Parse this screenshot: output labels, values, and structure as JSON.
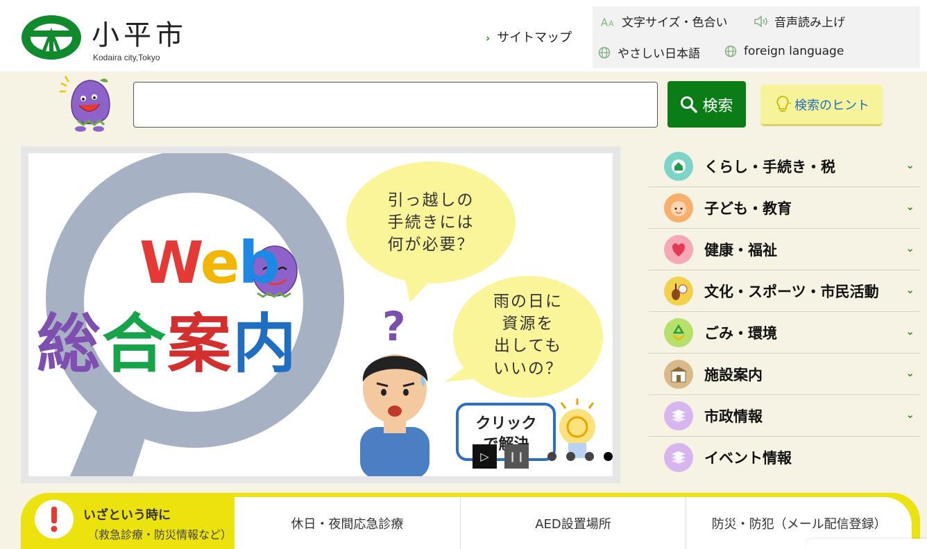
{
  "header": {
    "logo_name": "小平市",
    "logo_sub": "Kodaira city,Tokyo",
    "sitemap_label": "サイトマップ",
    "utility": {
      "font_color_label": "文字サイズ・色合い",
      "voice_label": "音声読み上げ",
      "easy_japanese_label": "やさしい日本語",
      "foreign_language_label": "foreign language"
    }
  },
  "search": {
    "value": "",
    "button_label": "検索",
    "hint_label": "検索のヒント"
  },
  "banner": {
    "title_web": "Web",
    "title_main": [
      "総",
      "合",
      "案",
      "内"
    ],
    "bubble1": [
      "引っ越しの",
      "手続きには",
      "何が必要？"
    ],
    "bubble2": [
      "雨の日に",
      "資源を",
      "出しても",
      "いいの？"
    ],
    "click_text": [
      "クリック",
      "で解決"
    ],
    "slide_count": 4,
    "active_slide": 4
  },
  "categories": [
    {
      "label": "くらし・手続き・税",
      "icon": "house-icon",
      "color": "#7fd4c8",
      "chevron": true
    },
    {
      "label": "子ども・教育",
      "icon": "child-face-icon",
      "color": "#f7b06b",
      "chevron": true
    },
    {
      "label": "健康・福祉",
      "icon": "heart-icon",
      "color": "#f5a9b8",
      "chevron": true
    },
    {
      "label": "文化・スポーツ・市民活動",
      "icon": "violin-icon",
      "color": "#f2d24a",
      "chevron": true
    },
    {
      "label": "ごみ・環境",
      "icon": "recycle-icon",
      "color": "#b5e06a",
      "chevron": true
    },
    {
      "label": "施設案内",
      "icon": "building-icon",
      "color": "#d9b98a",
      "chevron": true
    },
    {
      "label": "市政情報",
      "icon": "documents-icon",
      "color": "#d7b5ee",
      "chevron": true
    },
    {
      "label": "イベント情報",
      "icon": "documents-icon",
      "color": "#d7b5ee",
      "chevron": false
    }
  ],
  "emergency": {
    "title": "いざという時に",
    "subtitle": "（救急診療・防災情報など）",
    "links": [
      "休日・夜間応急診療",
      "AED設置場所",
      "防災・防犯（メール配信登録）"
    ]
  },
  "colors": {
    "brand_green": "#0a7d16",
    "page_bg": "#f6f3e4",
    "emergency_yellow": "#ebe20e"
  }
}
